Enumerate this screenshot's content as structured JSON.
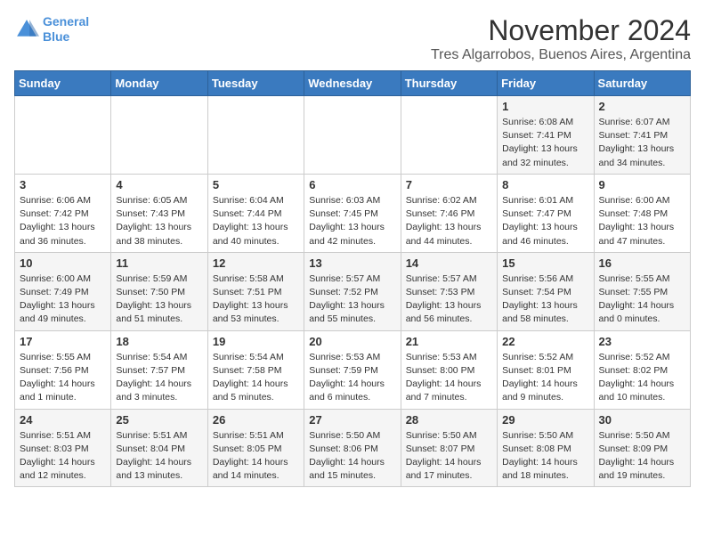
{
  "logo": {
    "line1": "General",
    "line2": "Blue"
  },
  "title": "November 2024",
  "location": "Tres Algarrobos, Buenos Aires, Argentina",
  "headers": [
    "Sunday",
    "Monday",
    "Tuesday",
    "Wednesday",
    "Thursday",
    "Friday",
    "Saturday"
  ],
  "weeks": [
    [
      {
        "day": "",
        "info": ""
      },
      {
        "day": "",
        "info": ""
      },
      {
        "day": "",
        "info": ""
      },
      {
        "day": "",
        "info": ""
      },
      {
        "day": "",
        "info": ""
      },
      {
        "day": "1",
        "info": "Sunrise: 6:08 AM\nSunset: 7:41 PM\nDaylight: 13 hours\nand 32 minutes."
      },
      {
        "day": "2",
        "info": "Sunrise: 6:07 AM\nSunset: 7:41 PM\nDaylight: 13 hours\nand 34 minutes."
      }
    ],
    [
      {
        "day": "3",
        "info": "Sunrise: 6:06 AM\nSunset: 7:42 PM\nDaylight: 13 hours\nand 36 minutes."
      },
      {
        "day": "4",
        "info": "Sunrise: 6:05 AM\nSunset: 7:43 PM\nDaylight: 13 hours\nand 38 minutes."
      },
      {
        "day": "5",
        "info": "Sunrise: 6:04 AM\nSunset: 7:44 PM\nDaylight: 13 hours\nand 40 minutes."
      },
      {
        "day": "6",
        "info": "Sunrise: 6:03 AM\nSunset: 7:45 PM\nDaylight: 13 hours\nand 42 minutes."
      },
      {
        "day": "7",
        "info": "Sunrise: 6:02 AM\nSunset: 7:46 PM\nDaylight: 13 hours\nand 44 minutes."
      },
      {
        "day": "8",
        "info": "Sunrise: 6:01 AM\nSunset: 7:47 PM\nDaylight: 13 hours\nand 46 minutes."
      },
      {
        "day": "9",
        "info": "Sunrise: 6:00 AM\nSunset: 7:48 PM\nDaylight: 13 hours\nand 47 minutes."
      }
    ],
    [
      {
        "day": "10",
        "info": "Sunrise: 6:00 AM\nSunset: 7:49 PM\nDaylight: 13 hours\nand 49 minutes."
      },
      {
        "day": "11",
        "info": "Sunrise: 5:59 AM\nSunset: 7:50 PM\nDaylight: 13 hours\nand 51 minutes."
      },
      {
        "day": "12",
        "info": "Sunrise: 5:58 AM\nSunset: 7:51 PM\nDaylight: 13 hours\nand 53 minutes."
      },
      {
        "day": "13",
        "info": "Sunrise: 5:57 AM\nSunset: 7:52 PM\nDaylight: 13 hours\nand 55 minutes."
      },
      {
        "day": "14",
        "info": "Sunrise: 5:57 AM\nSunset: 7:53 PM\nDaylight: 13 hours\nand 56 minutes."
      },
      {
        "day": "15",
        "info": "Sunrise: 5:56 AM\nSunset: 7:54 PM\nDaylight: 13 hours\nand 58 minutes."
      },
      {
        "day": "16",
        "info": "Sunrise: 5:55 AM\nSunset: 7:55 PM\nDaylight: 14 hours\nand 0 minutes."
      }
    ],
    [
      {
        "day": "17",
        "info": "Sunrise: 5:55 AM\nSunset: 7:56 PM\nDaylight: 14 hours\nand 1 minute."
      },
      {
        "day": "18",
        "info": "Sunrise: 5:54 AM\nSunset: 7:57 PM\nDaylight: 14 hours\nand 3 minutes."
      },
      {
        "day": "19",
        "info": "Sunrise: 5:54 AM\nSunset: 7:58 PM\nDaylight: 14 hours\nand 5 minutes."
      },
      {
        "day": "20",
        "info": "Sunrise: 5:53 AM\nSunset: 7:59 PM\nDaylight: 14 hours\nand 6 minutes."
      },
      {
        "day": "21",
        "info": "Sunrise: 5:53 AM\nSunset: 8:00 PM\nDaylight: 14 hours\nand 7 minutes."
      },
      {
        "day": "22",
        "info": "Sunrise: 5:52 AM\nSunset: 8:01 PM\nDaylight: 14 hours\nand 9 minutes."
      },
      {
        "day": "23",
        "info": "Sunrise: 5:52 AM\nSunset: 8:02 PM\nDaylight: 14 hours\nand 10 minutes."
      }
    ],
    [
      {
        "day": "24",
        "info": "Sunrise: 5:51 AM\nSunset: 8:03 PM\nDaylight: 14 hours\nand 12 minutes."
      },
      {
        "day": "25",
        "info": "Sunrise: 5:51 AM\nSunset: 8:04 PM\nDaylight: 14 hours\nand 13 minutes."
      },
      {
        "day": "26",
        "info": "Sunrise: 5:51 AM\nSunset: 8:05 PM\nDaylight: 14 hours\nand 14 minutes."
      },
      {
        "day": "27",
        "info": "Sunrise: 5:50 AM\nSunset: 8:06 PM\nDaylight: 14 hours\nand 15 minutes."
      },
      {
        "day": "28",
        "info": "Sunrise: 5:50 AM\nSunset: 8:07 PM\nDaylight: 14 hours\nand 17 minutes."
      },
      {
        "day": "29",
        "info": "Sunrise: 5:50 AM\nSunset: 8:08 PM\nDaylight: 14 hours\nand 18 minutes."
      },
      {
        "day": "30",
        "info": "Sunrise: 5:50 AM\nSunset: 8:09 PM\nDaylight: 14 hours\nand 19 minutes."
      }
    ]
  ]
}
